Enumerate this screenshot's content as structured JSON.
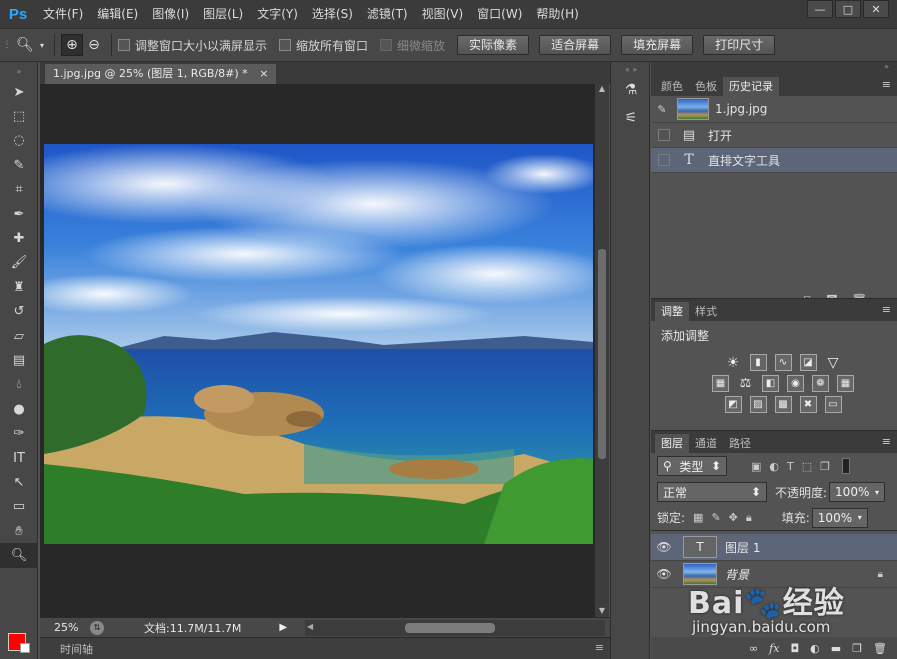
{
  "app": {
    "logo": "Ps",
    "menu": [
      "文件(F)",
      "编辑(E)",
      "图像(I)",
      "图层(L)",
      "文字(Y)",
      "选择(S)",
      "滤镜(T)",
      "视图(V)",
      "窗口(W)",
      "帮助(H)"
    ],
    "window_controls": [
      "—",
      "□",
      "✕"
    ]
  },
  "options": {
    "checkbox_fit_window": "调整窗口大小以满屏显示",
    "checkbox_zoom_all": "缩放所有窗口",
    "checkbox_scrubby": "细微缩放",
    "btn_actual_pixels": "实际像素",
    "btn_fit_screen": "适合屏幕",
    "btn_fill_screen": "填充屏幕",
    "btn_print_size": "打印尺寸"
  },
  "document": {
    "tab_title": "1.jpg.jpg @ 25% (图层 1, RGB/8#) *",
    "tab_close": "×",
    "zoom": "25%",
    "doc_info": "文档:11.7M/11.7M",
    "timeline_tab": "时间轴"
  },
  "panels": {
    "history_tabs": [
      "颜色",
      "色板",
      "历史记录"
    ],
    "history_active": 2,
    "history_snapshot": "1.jpg.jpg",
    "history_items": [
      {
        "label": "打开",
        "icon": "document-icon"
      },
      {
        "label": "直排文字工具",
        "icon": "type-tool-icon"
      }
    ],
    "adjust_tabs": [
      "调整",
      "样式"
    ],
    "adjust_title": "添加调整",
    "layers_tabs": [
      "图层",
      "通道",
      "路径"
    ],
    "layer_filter": "类型",
    "blend_mode": "正常",
    "opacity_label": "不透明度:",
    "opacity_value": "100%",
    "lock_label": "锁定:",
    "fill_label": "填充:",
    "fill_value": "100%",
    "layers": [
      {
        "name": "图层 1",
        "type": "text"
      },
      {
        "name": "背景",
        "type": "image"
      }
    ]
  },
  "watermark": {
    "brand": "Bai🐾经验",
    "url": "jingyan.baidu.com"
  }
}
